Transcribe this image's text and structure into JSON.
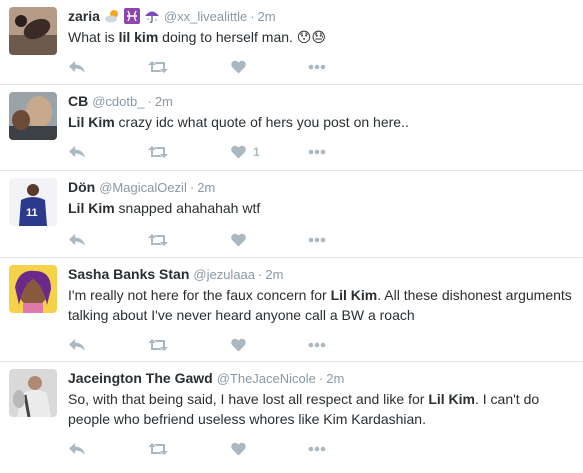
{
  "tweets": [
    {
      "fullname": "zaria",
      "username": "@xx_livealittle",
      "time": "2m",
      "emoji": [
        "sun-behind-cloud-emoji",
        "pisces-emoji",
        "umbrella-emoji"
      ],
      "text_pre": "What is ",
      "text_bold": "lil kim",
      "text_post": " doing to herself man. 😯😓",
      "like_count": ""
    },
    {
      "fullname": "CB",
      "username": "@cdotb_",
      "time": "2m",
      "text_pre": "",
      "text_bold": "Lil Kim",
      "text_post": " crazy idc what quote of hers you post on here..",
      "like_count": "1"
    },
    {
      "fullname": "Dön",
      "username": "@MagicalOezil",
      "time": "2m",
      "text_pre": "",
      "text_bold": "Lil Kim",
      "text_post": " snapped ahahahah wtf",
      "like_count": ""
    },
    {
      "fullname": "Sasha Banks Stan",
      "username": "@jezulaaa",
      "time": "2m",
      "text_pre": "I'm really not here for the faux concern for ",
      "text_bold": "Lil Kim",
      "text_post": ". All these dishonest arguments talking about I've never heard anyone call a BW a roach",
      "like_count": ""
    },
    {
      "fullname": "Jaceington The Gawd",
      "username": "@TheJaceNicole",
      "time": "2m",
      "text_pre": "So, with that being said, I have lost all respect and like for ",
      "text_bold": "Lil Kim",
      "text_post": ". I can't do people who befriend useless whores like Kim Kardashian.",
      "like_count": ""
    }
  ],
  "separator": "·",
  "icons": {
    "reply": "reply-icon",
    "retweet": "retweet-icon",
    "like": "heart-icon",
    "more": "more-icon"
  },
  "colors": {
    "action_gray": "#aab8c2",
    "meta_gray": "#8899a6",
    "text": "#292f33",
    "divider": "#e1e8ed"
  }
}
